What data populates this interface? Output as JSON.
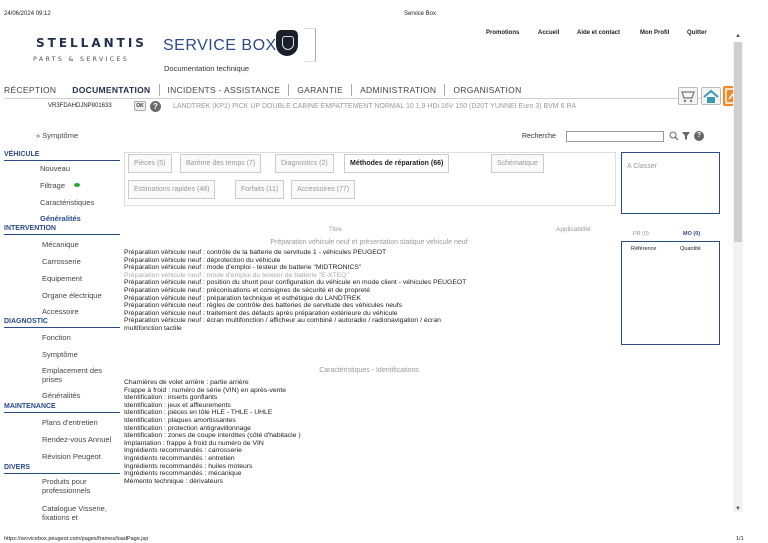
{
  "print_header": {
    "datetime": "24/06/2024 09:12",
    "page_title": "Service Box"
  },
  "brand": {
    "company": "STELLANTIS",
    "tagline": "PARTS & SERVICES",
    "product": "SERVICE BOX",
    "subtitle": "Documentation technique"
  },
  "top_links": [
    "Promotions",
    "Accueil",
    "Aide et contact",
    "Mon Profil",
    "Quitter"
  ],
  "main_nav": [
    "RÉCEPTION",
    "DOCUMENTATION",
    "INCIDENTS - ASSISTANCE",
    "GARANTIE",
    "ADMINISTRATION",
    "ORGANISATION"
  ],
  "vehicle_bar": {
    "vin": "VR3FDAHDJNP801633",
    "ok_label": "OK",
    "help_label": "?",
    "description": "LANDTREK (KP1) PICK UP DOUBLE CABINE EMPATTEMENT NORMAL 10 1,9 HDi 16V 150 (D20T YUNNEI Euro 3) BVM 6 RA"
  },
  "symptome_link": "Symptôme",
  "recherche_label": "Recherche",
  "sidebar": {
    "sections": [
      {
        "title": "VÉHICULE",
        "items": [
          "Nouveau",
          "Filtrage",
          "Caractéristiques",
          "Généralités"
        ]
      },
      {
        "title": "INTERVENTION",
        "items": [
          "Mécanique",
          "Carrosserie",
          "Equipement",
          "Organe électrique",
          "Accessoire"
        ]
      },
      {
        "title": "DIAGNOSTIC",
        "items": [
          "Fonction",
          "Symptôme",
          "Emplacement des prises",
          "Généralités"
        ]
      },
      {
        "title": "MAINTENANCE",
        "items": [
          "Plans d'entretien",
          "Rendez-vous Annuel",
          "Révision Peugeot"
        ]
      },
      {
        "title": "DIVERS",
        "items": [
          "Produits pour professionnels",
          "Catalogue Visserie, fixations et"
        ]
      }
    ]
  },
  "tabs": [
    "Pièces (5)",
    "Barème des temps (7)",
    "Diagnostics (2)",
    "Méthodes de réparation (66)",
    "Schématique",
    "Estimations rapides (48)",
    "Forfaits (11)",
    "Accessoires (77)"
  ],
  "right_panel": {
    "title": "A Classer",
    "pr_label": "PR (0)",
    "mo_label": "MO (0)",
    "ref_label": "Référence",
    "qty_label": "Quantité"
  },
  "columns": {
    "title": "Titre",
    "applicability": "Applicabilité"
  },
  "section1_title": "Préparation véhicule neuf et présentation statique véhicule neuf",
  "section1_rows": [
    {
      "text": "Préparation véhicule neuf : contrôle de la batterie de servitude 1 - véhicules PEUGEOT",
      "grey": false
    },
    {
      "text": "Préparation véhicule neuf : déprotection du véhicule",
      "grey": false
    },
    {
      "text": "Préparation véhicule neuf : mode d'emploi - testeur de batterie \"MIDTRONICS\"",
      "grey": false
    },
    {
      "text": "Préparation véhicule neuf : mode d'emploi du testeur de batterie \"E-XTEQ\"",
      "grey": true
    },
    {
      "text": "Préparation véhicule neuf : position du shunt pour configuration du véhicule en mode client - véhicules PEUGEOT",
      "grey": false
    },
    {
      "text": "Préparation véhicule neuf : préconisations et consignes de sécurité et de propreté",
      "grey": false
    },
    {
      "text": "Préparation véhicule neuf : préparation technique et esthétique du LANDTREK",
      "grey": false
    },
    {
      "text": "Préparation véhicule neuf : règles de contrôle des batteries de servitude des véhicules neufs",
      "grey": false
    },
    {
      "text": "Préparation véhicule neuf : traitement des défauts après préparation extérieure du véhicule",
      "grey": false
    },
    {
      "text": "Préparation véhicule neuf : écran multifonction / afficheur au combiné / autoradio / radionavigation / écran",
      "grey": false
    },
    {
      "text": "multifonction tactile",
      "grey": false
    }
  ],
  "section2_title": "Caractéristiques - Identifications",
  "section2_rows": [
    "Charnières de volet arrière : partie arrière",
    "Frappe à froid : numéro de série (VIN) en après-vente",
    "Identification : inserts gonflants",
    "Identification : jeux et affleurements",
    "Identification : pièces en tôle HLE - THLE - UHLE",
    "Identification : plaques amortissantes",
    "Identification : protection antigravillonnage",
    "Identification : zones de coupe interdites (côté d'habitacle )",
    "Implantation : frappe à froid du numéro de VIN",
    "Ingrédients recommandés : carrosserie",
    "Ingrédients recommandés : entretien",
    "Ingrédients recommandés : huiles moteurs",
    "Ingrédients recommandés : mécanique",
    "Mémento technique : dérivateurs"
  ],
  "footer": {
    "url": "https://servicebox.peugeot.com/pages/frames/loadPage.jsp",
    "page": "1/1"
  },
  "colors": {
    "accent": "#2a4a8a",
    "brand_navy": "#1f2f4c",
    "home_icon": "#3a9ab0",
    "manual_icon": "#f08a24",
    "filter_dot": "#2fa32f"
  }
}
